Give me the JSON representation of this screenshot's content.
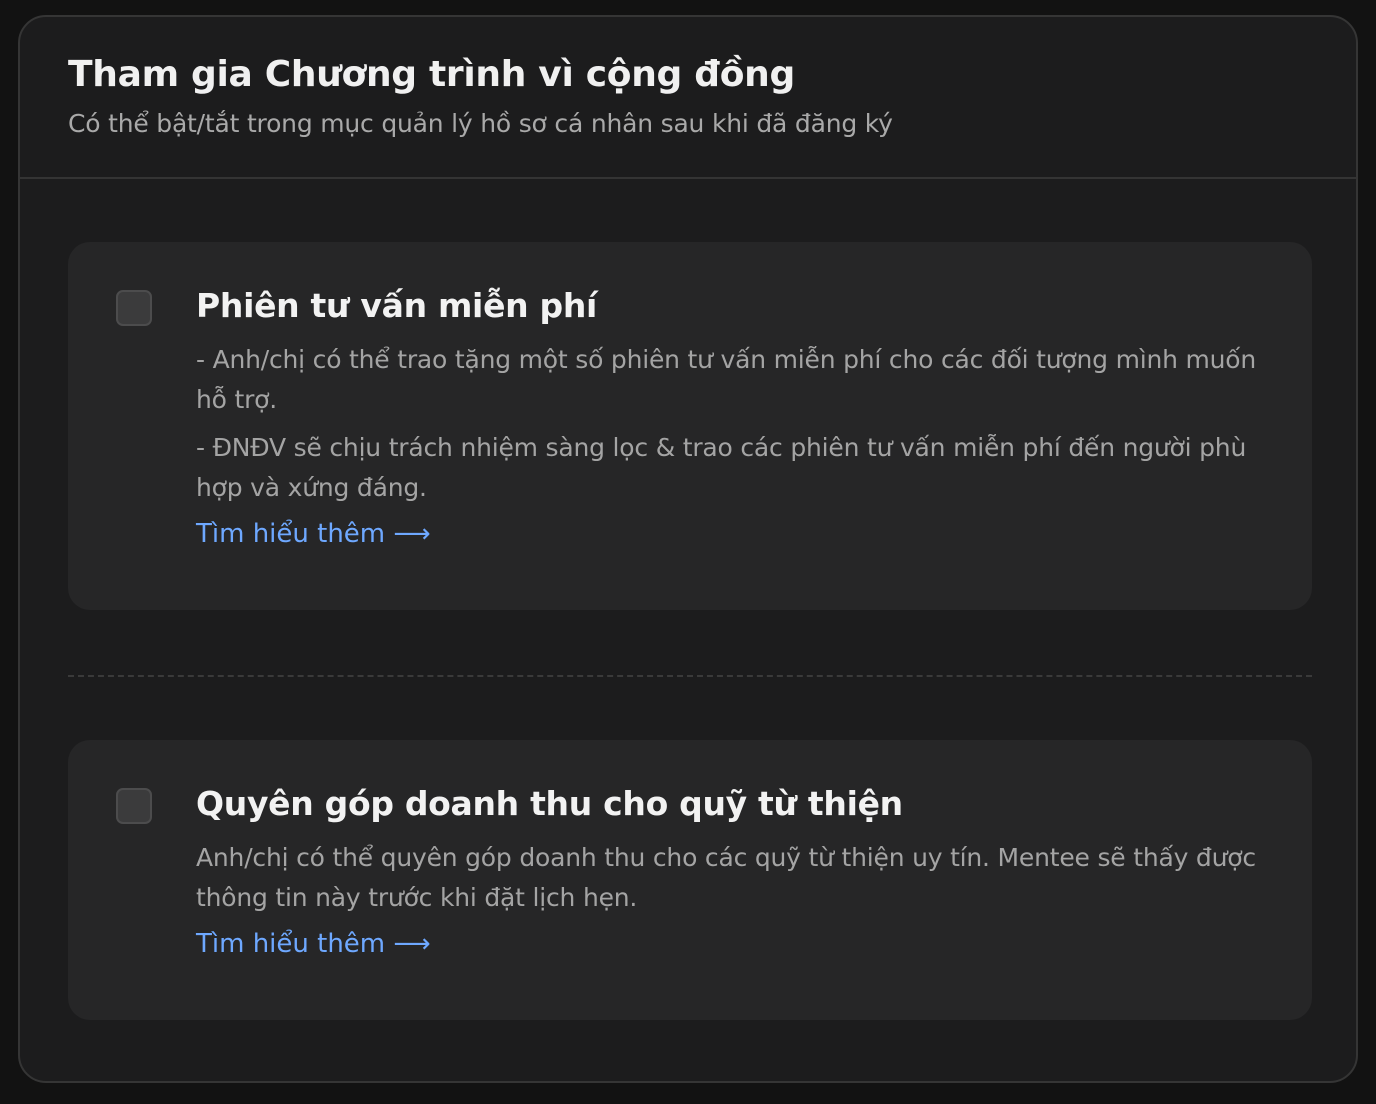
{
  "header": {
    "title": "Tham gia Chương trình vì cộng đồng",
    "subtitle": "Có thể bật/tắt trong mục quản lý hồ sơ cá nhân sau khi đã đăng ký"
  },
  "options": [
    {
      "title": "Phiên tư vấn miễn phí",
      "checked": false,
      "descriptions": [
        "- Anh/chị có thể trao tặng một số phiên tư vấn miễn phí cho các đối tượng mình muốn hỗ trợ.",
        "- ĐNĐV sẽ chịu trách nhiệm sàng lọc & trao các phiên tư vấn miễn phí đến người phù hợp và xứng đáng."
      ],
      "link_label": "Tìm hiểu thêm ⟶"
    },
    {
      "title": "Quyên góp doanh thu cho quỹ từ thiện",
      "checked": false,
      "descriptions": [
        "Anh/chị có thể quyên góp doanh thu cho các quỹ từ thiện uy tín. Mentee sẽ thấy được thông tin này trước khi đặt lịch hẹn."
      ],
      "link_label": "Tìm hiểu thêm ⟶"
    }
  ],
  "colors": {
    "background": "#121212",
    "panel": "#1c1c1d",
    "card": "#262627",
    "link": "#6ea8ff"
  }
}
